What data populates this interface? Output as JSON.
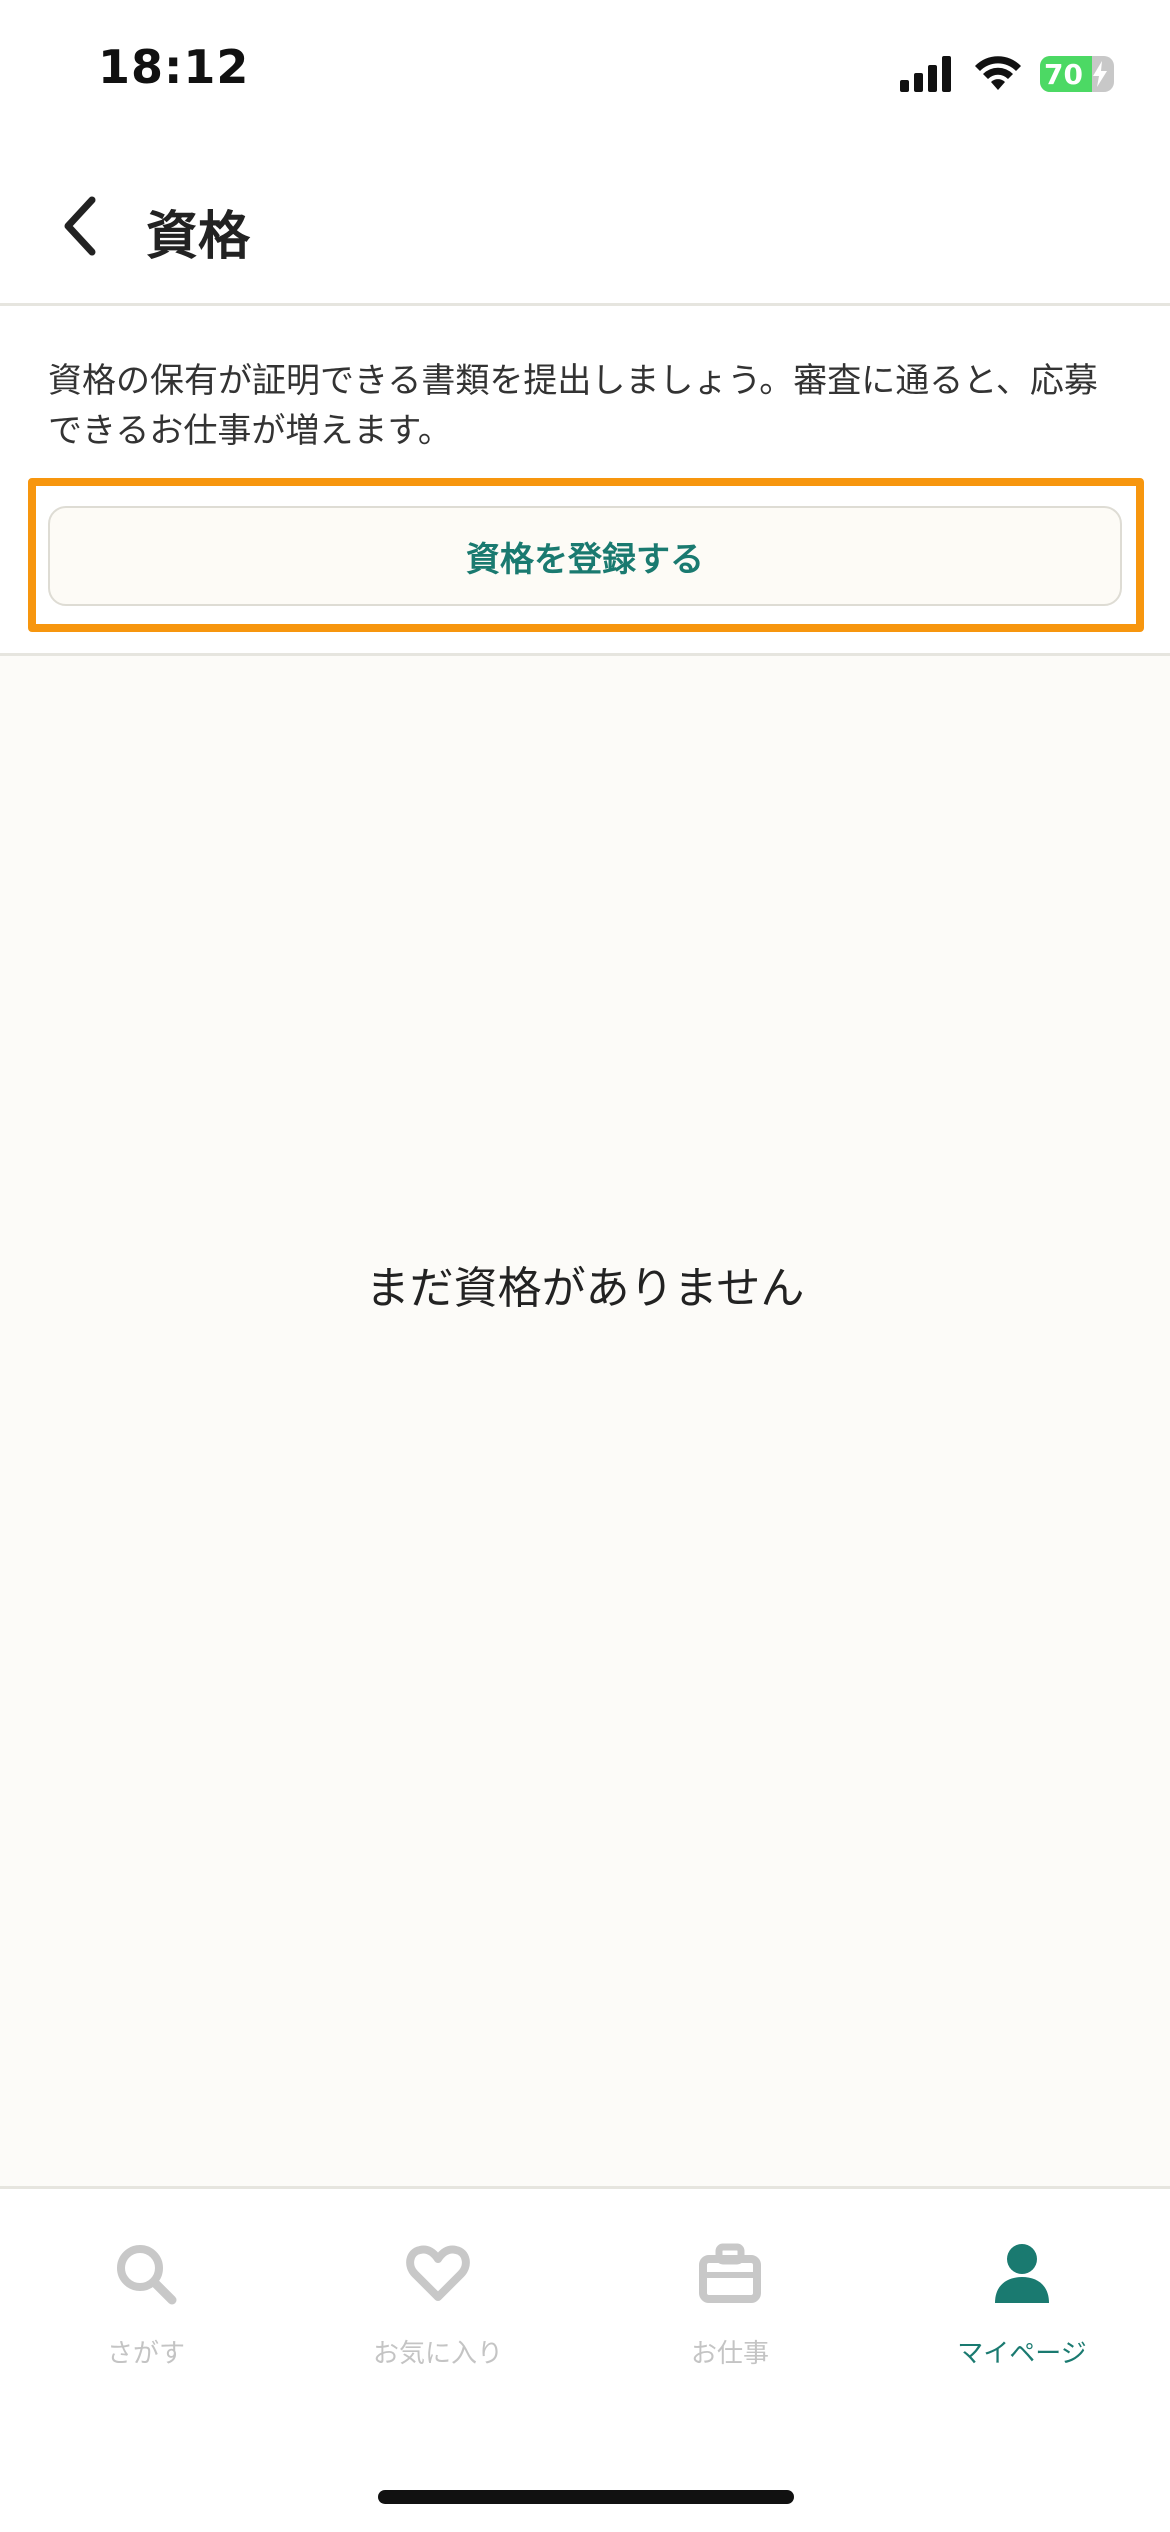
{
  "status_bar": {
    "time": "18:12",
    "battery_level": "70",
    "icons": [
      "signal-icon",
      "wifi-icon",
      "battery-icon"
    ]
  },
  "header": {
    "back_icon": "chevron-left-icon",
    "title": "資格"
  },
  "info": {
    "description": "資格の保有が証明できる書類を提出しましょう。審査に通ると、応募できるお仕事が増えます。",
    "register_button_label": "資格を登録する"
  },
  "empty_state": {
    "message": "まだ資格がありません"
  },
  "tab_bar": {
    "tabs": [
      {
        "label": "さがす",
        "icon": "search-icon",
        "active": false
      },
      {
        "label": "お気に入り",
        "icon": "heart-icon",
        "active": false
      },
      {
        "label": "お仕事",
        "icon": "briefcase-icon",
        "active": false
      },
      {
        "label": "マイページ",
        "icon": "person-icon",
        "active": true
      }
    ]
  },
  "colors": {
    "accent": "#1a7a70",
    "highlight": "#f7960e",
    "inactive": "#c4c4c4",
    "battery": "#4cd964"
  }
}
